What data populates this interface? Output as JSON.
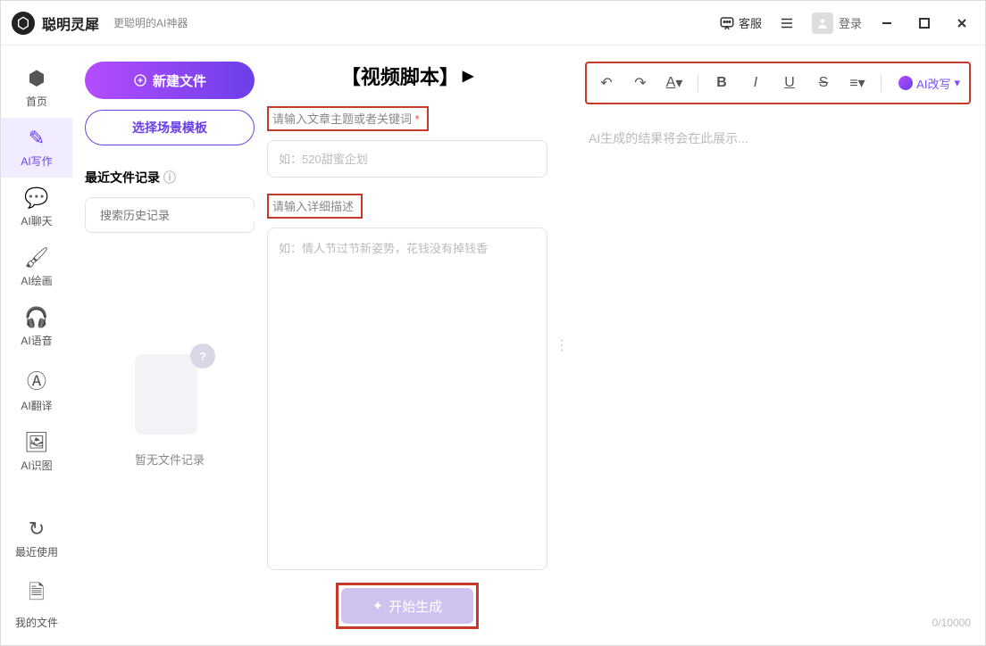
{
  "app": {
    "title": "聪明灵犀",
    "subtitle": "更聪明的AI神器"
  },
  "titlebar": {
    "support": "客服",
    "login": "登录"
  },
  "sidebar": {
    "items": [
      {
        "label": "首页",
        "icon": "home"
      },
      {
        "label": "AI写作",
        "icon": "pen"
      },
      {
        "label": "AI聊天",
        "icon": "chat"
      },
      {
        "label": "AI绘画",
        "icon": "brush"
      },
      {
        "label": "AI语音",
        "icon": "audio"
      },
      {
        "label": "AI翻译",
        "icon": "translate"
      },
      {
        "label": "AI识图",
        "icon": "image"
      },
      {
        "label": "最近使用",
        "icon": "clock"
      },
      {
        "label": "我的文件",
        "icon": "file"
      }
    ]
  },
  "col1": {
    "newfile": "新建文件",
    "template": "选择场景模板",
    "recent": "最近文件记录",
    "search_ph": "搜索历史记录",
    "empty": "暂无文件记录"
  },
  "col2": {
    "title": "【视频脚本】",
    "label1": "请输入文章主题或者关键词",
    "ph1": "如：520甜蜜企划",
    "label2": "请输入详细描述",
    "ph2": "如：情人节过节新姿势，花钱没有掉钱香",
    "generate": "开始生成"
  },
  "col3": {
    "rewrite": "AI改写",
    "placeholder": "AI生成的结果将会在此展示...",
    "counter": "0/10000"
  }
}
